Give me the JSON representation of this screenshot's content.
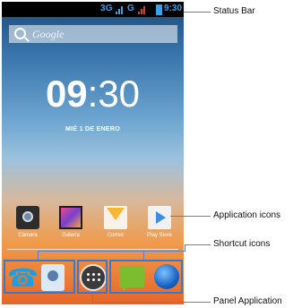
{
  "status_bar": {
    "network": "3G",
    "network2": "G",
    "time": "9:30"
  },
  "search": {
    "placeholder": "Google"
  },
  "clock": {
    "hours": "09",
    "minutes": "30",
    "date": "MIÉ 1 DE ENERO"
  },
  "apps": [
    {
      "label": "Cámara",
      "icon": "camera-icon"
    },
    {
      "label": "Galería",
      "icon": "gallery-icon"
    },
    {
      "label": "Correo",
      "icon": "mail-icon"
    },
    {
      "label": "Play Store",
      "icon": "play-store-icon"
    }
  ],
  "dock": [
    {
      "icon": "phone-icon"
    },
    {
      "icon": "contacts-icon"
    },
    {
      "icon": "apps-panel-icon"
    },
    {
      "icon": "messaging-icon"
    },
    {
      "icon": "browser-icon"
    }
  ],
  "callouts": {
    "status_bar": "Status Bar",
    "application_icons": "Application icons",
    "shortcut_icons": "Shortcut icons",
    "panel_application": "Panel Application"
  },
  "colors": {
    "accent_line": "#5b7fc3",
    "status_text": "#3aa0e8"
  }
}
